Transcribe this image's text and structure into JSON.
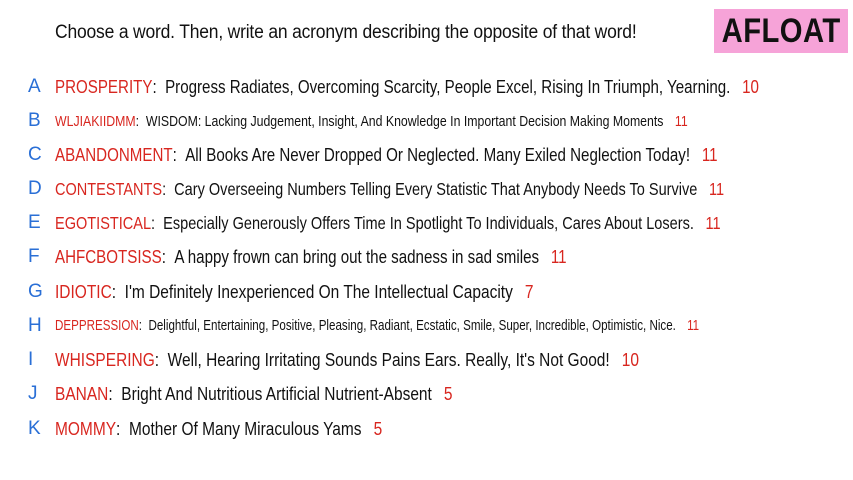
{
  "prompt": "Choose a word. Then, write an acronym describing the opposite of that word!",
  "badge": "AFLOAT",
  "colors": {
    "letter": "#2a6fd6",
    "word": "#d8261f",
    "count": "#d8261f",
    "badge_bg": "#f6a3d8"
  },
  "entries": [
    {
      "letter": "A",
      "word": "PROSPERITY",
      "text": "Progress Radiates, Overcoming Scarcity, People Excel, Rising In Triumph, Yearning.",
      "count": "10"
    },
    {
      "letter": "B",
      "word": "WLJIAKIIDMM",
      "text": "WISDOM: Lacking Judgement, Insight, And Knowledge In Important Decision Making Moments",
      "count": "11"
    },
    {
      "letter": "C",
      "word": "ABANDONMENT",
      "text": "All Books Are Never Dropped Or Neglected. Many Exiled Neglection Today!",
      "count": "11"
    },
    {
      "letter": "D",
      "word": "CONTESTANTS",
      "text": "Cary Overseeing Numbers Telling Every Statistic That Anybody Needs To Survive",
      "count": "11"
    },
    {
      "letter": "E",
      "word": "EGOTISTICAL",
      "text": "Especially Generously Offers Time In Spotlight To Individuals, Cares About Losers.",
      "count": "11"
    },
    {
      "letter": "F",
      "word": "AHFCBOTSISS",
      "text": "A happy frown can bring out the sadness in sad smiles",
      "count": "11"
    },
    {
      "letter": "G",
      "word": "IDIOTIC",
      "text": "I'm Definitely Inexperienced On The Intellectual Capacity",
      "count": "7"
    },
    {
      "letter": "H",
      "word": "DEPPRESSION",
      "text": "Delightful, Entertaining, Positive, Pleasing, Radiant, Ecstatic, Smile, Super, Incredible, Optimistic, Nice.",
      "count": "11"
    },
    {
      "letter": "I",
      "word": "WHISPERING",
      "text": "Well, Hearing Irritating Sounds Pains Ears. Really, It's Not Good!",
      "count": "10"
    },
    {
      "letter": "J",
      "word": "BANAN",
      "text": "Bright And Nutritious Artificial Nutrient-Absent",
      "count": "5"
    },
    {
      "letter": "K",
      "word": "MOMMY",
      "text": "Mother Of Many Miraculous Yams",
      "count": "5"
    }
  ]
}
